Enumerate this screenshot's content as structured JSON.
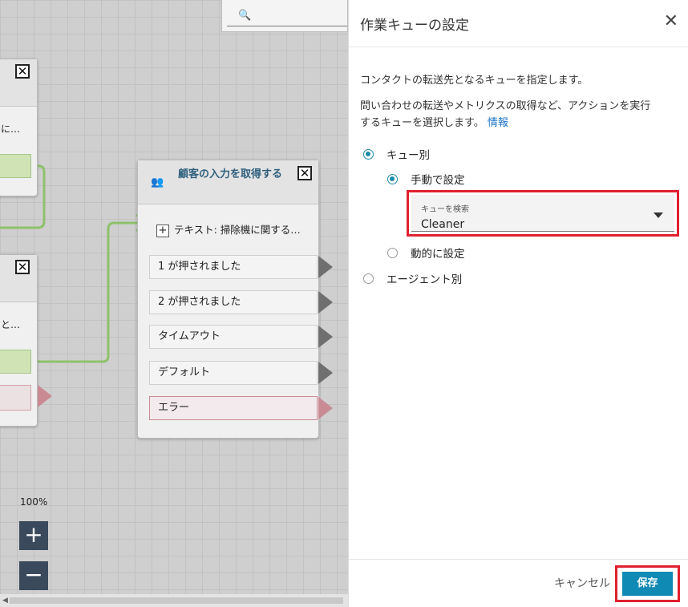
{
  "canvas": {
    "zoom_level": "100%",
    "zoom_in": "+",
    "zoom_out": "−",
    "left_block_1": {
      "text": "に…"
    },
    "left_block_2": {
      "text": "と…"
    },
    "main_block": {
      "title": "顧客の入力を取得する",
      "prompt": "テキスト: 掃除機に関する…",
      "branches": [
        "1 が押されました",
        "2 が押されました",
        "タイムアウト",
        "デフォルト",
        "エラー"
      ]
    },
    "colors": {
      "green_connector": "#8fc16a",
      "pink_error": "#c98a94"
    }
  },
  "panel": {
    "title": "作業キューの設定",
    "description_1": "コンタクトの転送先となるキューを指定します。",
    "description_2_line1": "問い合わせの転送やメトリクスの取得など、アクションを実行",
    "description_2_line2": "するキューを選択します。",
    "info_link": "情報",
    "options": {
      "by_queue": "キュー別",
      "manual": "手動で設定",
      "dynamic": "動的に設定",
      "by_agent": "エージェント別"
    },
    "queue_select": {
      "label": "キューを検索",
      "value": "Cleaner"
    },
    "cancel": "キャンセル",
    "save": "保存"
  }
}
